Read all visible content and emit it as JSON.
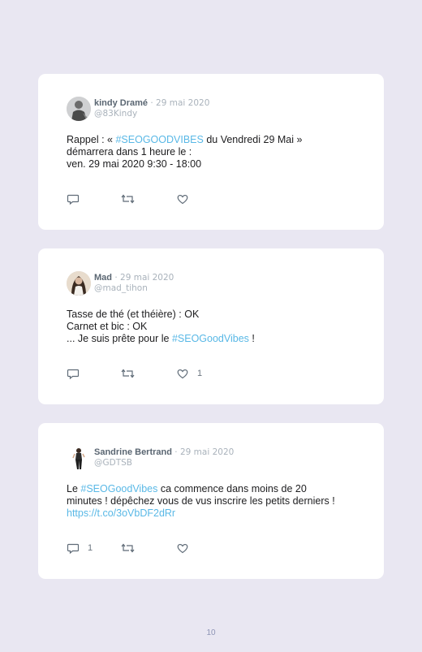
{
  "tweets": [
    {
      "name": "kindy Dramé",
      "date": " · 29 mai 2020",
      "handle": "@83Kindy",
      "lines": [
        {
          "t1": "Rappel : « ",
          "tag": "#SEOGOODVIBES",
          "t2": " du Vendredi 29 Mai »"
        },
        {
          "t1": "démarrera dans 1 heure le :"
        },
        {
          "t1": "ven. 29 mai 2020 9:30 - 18:00"
        }
      ],
      "reply_count": "",
      "like_count": ""
    },
    {
      "name": "Mad",
      "date": " · 29 mai 2020",
      "handle": "@mad_tihon",
      "lines": [
        {
          "t1": "Tasse de thé (et théière) : OK"
        },
        {
          "t1": "Carnet et bic : OK"
        },
        {
          "t1": "... Je suis prête pour le ",
          "tag": "#SEOGoodVibes",
          "t2": " !"
        }
      ],
      "reply_count": "",
      "like_count": "1"
    },
    {
      "name": "Sandrine Bertrand",
      "date": " · 29 mai 2020",
      "handle": "@GDTSB",
      "lines": [
        {
          "t1": "Le ",
          "tag": "#SEOGoodVibes",
          "t2": " ca commence dans moins de 20"
        },
        {
          "t1": "minutes ! dépêchez vous de vus inscrire les petits derniers !"
        },
        {
          "link": "https://t.co/3oVbDF2dRr"
        }
      ],
      "reply_count": "1",
      "like_count": ""
    }
  ],
  "icons": {
    "reply": "reply-icon",
    "retweet": "retweet-icon",
    "like": "like-icon"
  },
  "colors": {
    "background": "#e9e7f2",
    "hashtag": "#59b8e6",
    "name": "#5a6672",
    "muted": "#a9b2bb"
  },
  "page_number": "10"
}
